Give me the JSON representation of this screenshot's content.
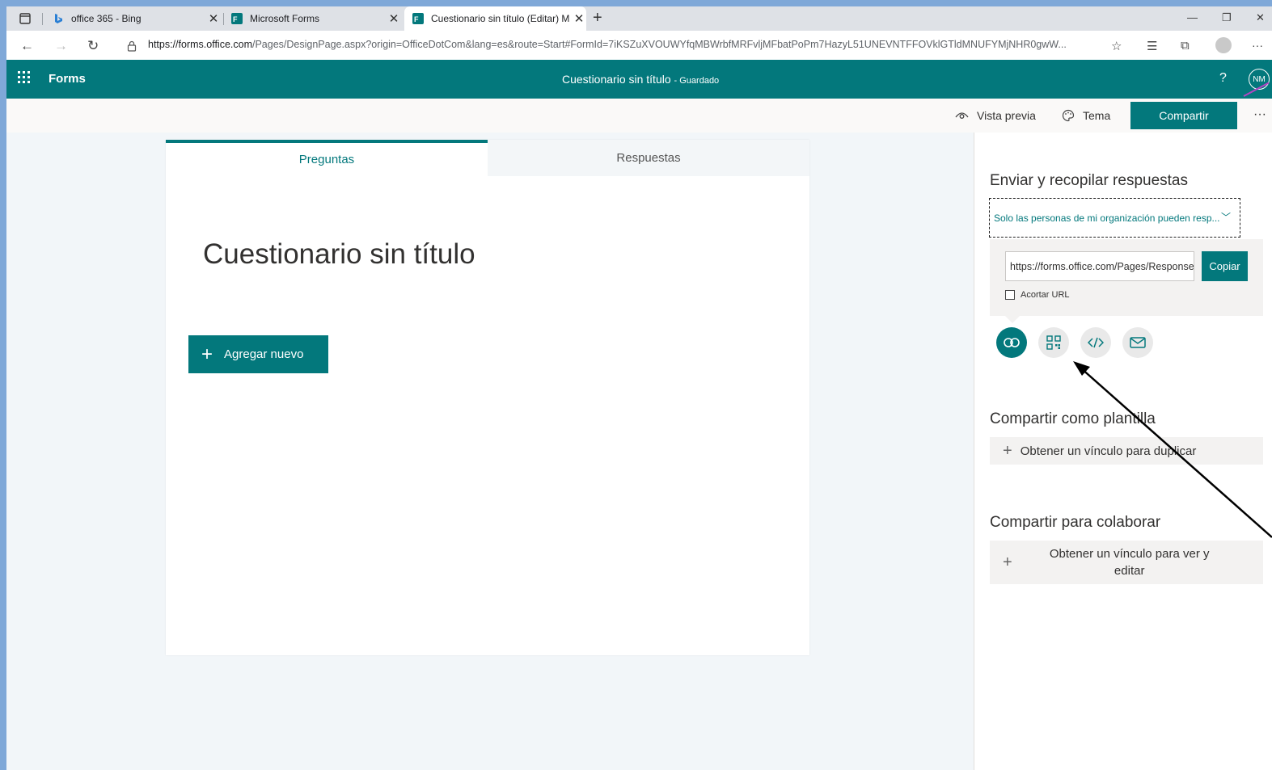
{
  "browser": {
    "tabs": [
      {
        "title": "office 365 - Bing"
      },
      {
        "title": "Microsoft Forms"
      },
      {
        "title": "Cuestionario sin título (Editar) M"
      }
    ],
    "url_host": "https://forms.office.com",
    "url_rest": "/Pages/DesignPage.aspx?origin=OfficeDotCom&lang=es&route=Start#FormId=7iKSZuXVOUWYfqMBWrbfMRFvljMFbatPoPm7HazyL51UNEVNTFFOVklGTldMNUFYMjNHR0gwW..."
  },
  "header": {
    "app_name": "Forms",
    "doc_title": "Cuestionario sin título",
    "saved_status": "- Guardado",
    "help": "?",
    "avatar": "NM"
  },
  "commands": {
    "preview": "Vista previa",
    "theme": "Tema",
    "share": "Compartir",
    "more": "···"
  },
  "form": {
    "tab_questions": "Preguntas",
    "tab_responses": "Respuestas",
    "title": "Cuestionario sin título",
    "add_new": "Agregar nuevo"
  },
  "share_panel": {
    "send_heading": "Enviar y recopilar respuestas",
    "audience": "Solo las personas de mi organización pueden resp...",
    "link": "https://forms.office.com/Pages/ResponsePage.aspx",
    "copy": "Copiar",
    "shorten": "Acortar URL",
    "template_heading": "Compartir como plantilla",
    "template_link": "Obtener un vínculo para duplicar",
    "collab_heading": "Compartir para colaborar",
    "collab_link": "Obtener un vínculo para ver y editar"
  },
  "colors": {
    "accent": "#03787c"
  }
}
